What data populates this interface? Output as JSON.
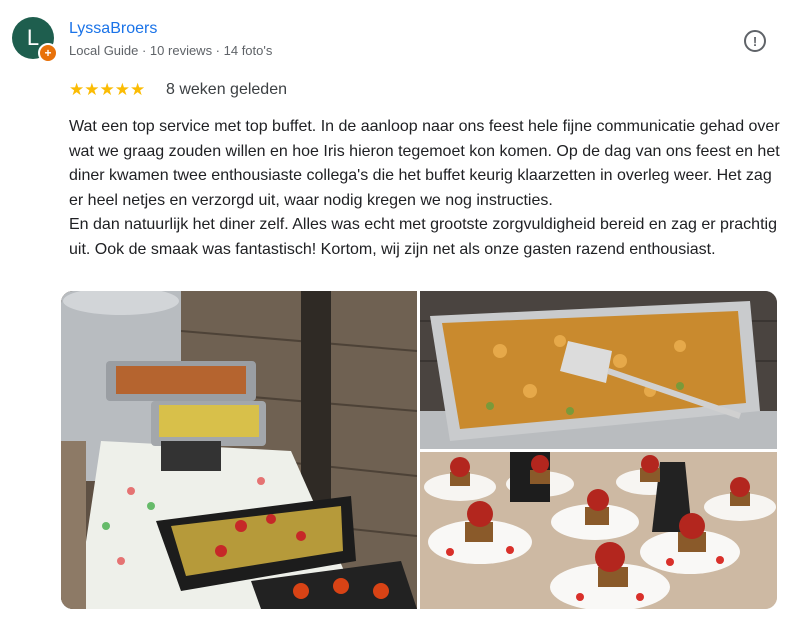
{
  "reviewer": {
    "initial": "L",
    "name": "LyssaBroers",
    "meta": "Local Guide · 10 reviews · 14 foto's"
  },
  "rating": {
    "stars": 5,
    "stars_text": "★★★★★",
    "time_ago": "8 weken geleden"
  },
  "review_text": "Wat een top service met top buffet. In de aanloop naar ons feest hele fijne communicatie gehad over wat we graag zouden willen en hoe Iris hieron tegemoet kon komen. Op de dag van ons feest en het diner kwamen twee enthousiaste collega's die het buffet keurig klaarzetten in overleg weer. Het zag er heel netjes en verzorgd uit, waar nodig kregen we nog instructies.\nEn dan natuurlijk het diner zelf. Alles was echt met grootste zorgvuldigheid bereid en zag er prachtig uit. Ook de smaak was fantastisch! Kortom, wij zijn net als onze gasten razend enthousiast.",
  "icons": {
    "report": "report-icon",
    "badge": "local-guide-badge-icon"
  },
  "colors": {
    "name": "#1a73e8",
    "stars": "#fbbc04",
    "avatar_bg": "#1e5e4e",
    "badge": "#e8710a"
  }
}
